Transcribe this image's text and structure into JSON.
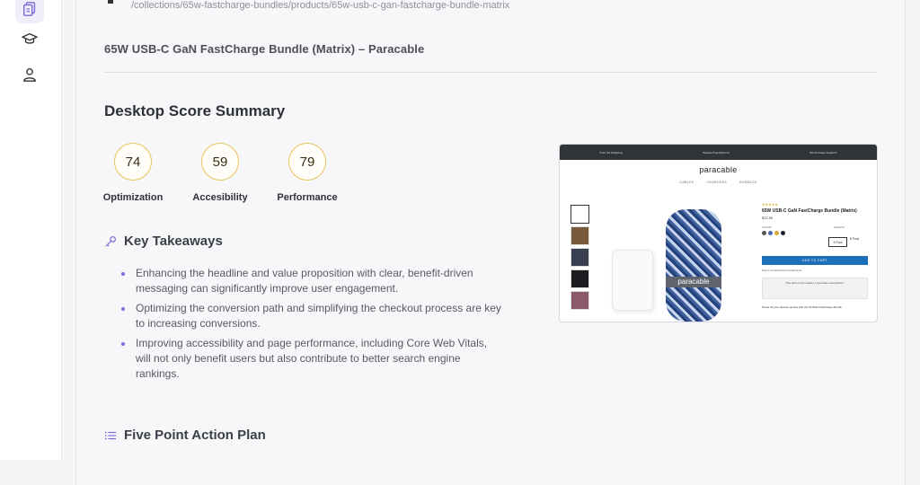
{
  "sidebar": {
    "items": [
      {
        "icon": "documents-icon",
        "active": true
      },
      {
        "icon": "graduation-cap-icon",
        "active": false
      },
      {
        "icon": "user-icon",
        "active": false
      }
    ]
  },
  "page": {
    "url": "/collections/65w-fastcharge-bundles/products/65w-usb-c-gan-fastcharge-bundle-matrix",
    "title": "65W USB-C GaN FastCharge Bundle (Matrix) – Paracable"
  },
  "summary": {
    "heading": "Desktop Score Summary",
    "scores": [
      {
        "value": "74",
        "label": "Optimization"
      },
      {
        "value": "59",
        "label": "Accesibility"
      },
      {
        "value": "79",
        "label": "Performance"
      }
    ],
    "score_ring_color": "#e8c35c"
  },
  "takeaways": {
    "heading": "Key Takeaways",
    "icon": "key-icon",
    "items": [
      "Enhancing the headline and value proposition with clear, benefit-driven messaging can significantly improve user engagement.",
      "Optimizing the conversion path and simplifying the checkout process are key to increasing conversions.",
      "Improving accessibility and page performance, including Core Web Vitals, will not only benefit users but also contribute to better search engine rankings."
    ]
  },
  "action_plan": {
    "heading": "Five Point Action Plan",
    "icon": "list-icon"
  },
  "preview": {
    "topbar": [
      "Free US Shipping",
      "Hassle-Free Returns",
      "World-Class Support"
    ],
    "logo": "paracable",
    "nav": [
      "CABLES",
      "CHARGERS",
      "BUNDLES"
    ],
    "product_title": "65W USB-C GaN FastCharge Bundle (Matrix)",
    "price": "$72.99",
    "color_label": "COLOR",
    "length_label": "LENGTH",
    "size_selected": "3 Foot",
    "size_other": "6 Foot",
    "add_to_cart": "ADD TO CART",
    "cable_label": "paracable",
    "accent_color": "#1d6fb8"
  }
}
